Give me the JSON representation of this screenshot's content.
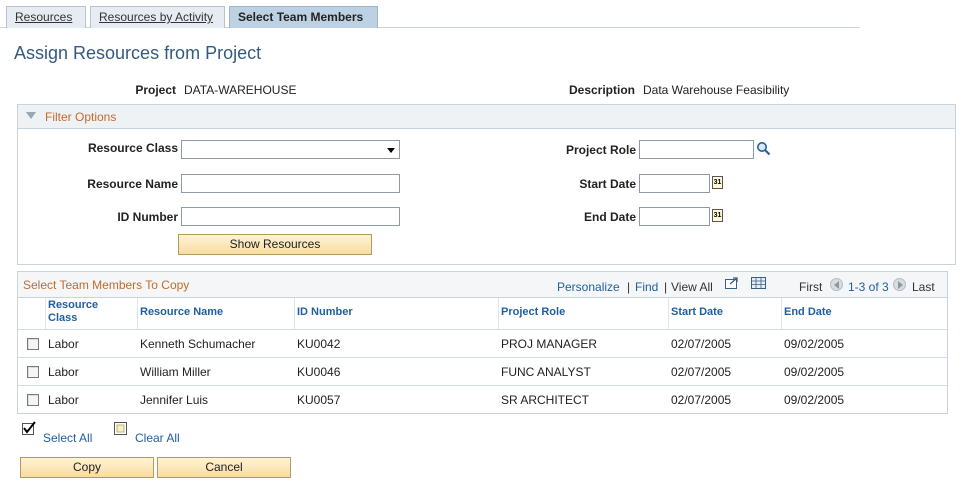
{
  "tabs": [
    {
      "label": "Resources",
      "active": false
    },
    {
      "label": "Resources by Activity",
      "active": false
    },
    {
      "label": "Select Team Members",
      "active": true
    }
  ],
  "page_title": "Assign Resources from Project",
  "project": {
    "label": "Project",
    "value": "DATA-WAREHOUSE"
  },
  "description": {
    "label": "Description",
    "value": "Data Warehouse Feasibility"
  },
  "filter": {
    "title": "Filter Options",
    "resource_class_label": "Resource Class",
    "resource_class_value": "",
    "resource_name_label": "Resource Name",
    "resource_name_value": "",
    "id_number_label": "ID Number",
    "id_number_value": "",
    "project_role_label": "Project Role",
    "project_role_value": "",
    "start_date_label": "Start Date",
    "start_date_value": "",
    "end_date_label": "End Date",
    "end_date_value": "",
    "calendar_glyph": "31",
    "show_button": "Show Resources"
  },
  "grid": {
    "title": "Select Team Members To Copy",
    "personalize": "Personalize",
    "find": "Find",
    "sep": "|",
    "view_all": "View All",
    "first": "First",
    "range": "1-3 of 3",
    "last": "Last",
    "columns": [
      "Resource Class",
      "Resource Name",
      "ID Number",
      "Project Role",
      "Start Date",
      "End Date"
    ],
    "rows": [
      {
        "checked": false,
        "resource_class": "Labor",
        "resource_name": "Kenneth Schumacher",
        "id_number": "KU0042",
        "project_role": "PROJ MANAGER",
        "start_date": "02/07/2005",
        "end_date": "09/02/2005"
      },
      {
        "checked": false,
        "resource_class": "Labor",
        "resource_name": "William Miller",
        "id_number": "KU0046",
        "project_role": "FUNC ANALYST",
        "start_date": "02/07/2005",
        "end_date": "09/02/2005"
      },
      {
        "checked": false,
        "resource_class": "Labor",
        "resource_name": "Jennifer Luis",
        "id_number": "KU0057",
        "project_role": "SR ARCHITECT",
        "start_date": "02/07/2005",
        "end_date": "09/02/2005"
      }
    ]
  },
  "select_all": "Select All",
  "clear_all": "Clear All",
  "copy_button": "Copy",
  "cancel_button": "Cancel",
  "colors": {
    "accent": "#c46a2b",
    "link": "#1f5f9f",
    "title": "#355a7f"
  }
}
